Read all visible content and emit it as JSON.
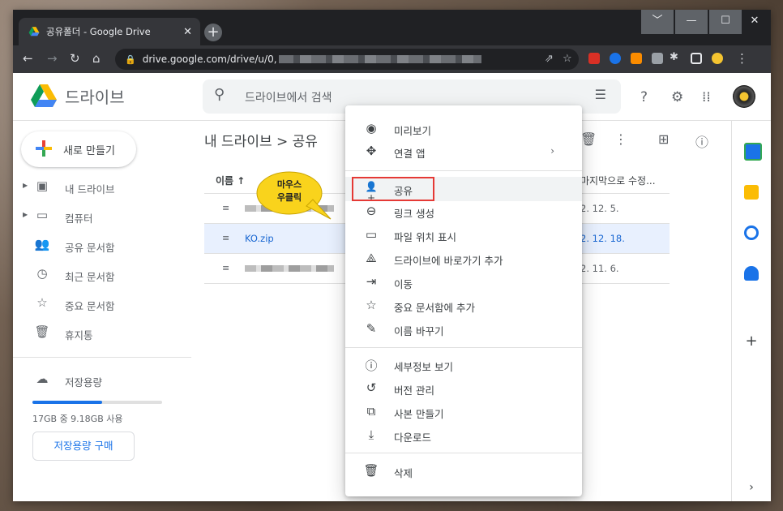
{
  "browser": {
    "tab_title": "공유폴더 - Google Drive",
    "tab_close": "✕",
    "new_tab": "+",
    "url": "drive.google.com/drive/u/0,",
    "window_controls": [
      "﹀",
      "—",
      "☐",
      "✕"
    ]
  },
  "drive": {
    "brand": "드라이브",
    "search_placeholder": "드라이브에서 검색",
    "new_button": "새로 만들기"
  },
  "sidebar": {
    "items": [
      {
        "label": "내 드라이브",
        "icon": "▣"
      },
      {
        "label": "컴퓨터",
        "icon": "▭"
      },
      {
        "label": "공유 문서함",
        "icon": "👥"
      },
      {
        "label": "최근 문서함",
        "icon": "◷"
      },
      {
        "label": "중요 문서함",
        "icon": "☆"
      },
      {
        "label": "휴지통",
        "icon": "🗑"
      }
    ],
    "storage_label": "저장용량",
    "storage_text": "17GB 중 9.18GB 사용",
    "storage_fraction": 0.54,
    "buy_button": "저장용량 구매"
  },
  "main": {
    "breadcrumb": "내 드라이브  >  공유",
    "col_name": "이름  ↑",
    "col_modified": "마지막으로 수정...",
    "rows": [
      {
        "name": "",
        "date": "2. 12. 5.",
        "selected": false
      },
      {
        "name": "KO.zip",
        "date": "2. 12. 18.",
        "selected": true
      },
      {
        "name": "",
        "date": "2. 11. 6.",
        "selected": false
      }
    ]
  },
  "callout": {
    "line1": "마우스",
    "line2": "우클릭"
  },
  "menu": {
    "items": [
      {
        "icon": "◉",
        "label": "미리보기"
      },
      {
        "icon": "✥",
        "label": "연결 앱",
        "arrow": "›"
      },
      {
        "icon": "👤+",
        "label": "공유"
      },
      {
        "icon": "⊖",
        "label": "링크 생성"
      },
      {
        "icon": "▭",
        "label": "파일 위치 표시"
      },
      {
        "icon": "⟁",
        "label": "드라이브에 바로가기 추가"
      },
      {
        "icon": "⇥",
        "label": "이동"
      },
      {
        "icon": "☆",
        "label": "중요 문서함에 추가"
      },
      {
        "icon": "✎",
        "label": "이름 바꾸기"
      },
      {
        "icon": "ⓘ",
        "label": "세부정보 보기"
      },
      {
        "icon": "↺",
        "label": "버전 관리"
      },
      {
        "icon": "⧉",
        "label": "사본 만들기"
      },
      {
        "icon": "⤓",
        "label": "다운로드"
      },
      {
        "icon": "🗑",
        "label": "삭제"
      }
    ]
  },
  "colors": {
    "accent": "#1a73e8",
    "highlight_box": "#e53935",
    "callout": "#f9d31c"
  }
}
